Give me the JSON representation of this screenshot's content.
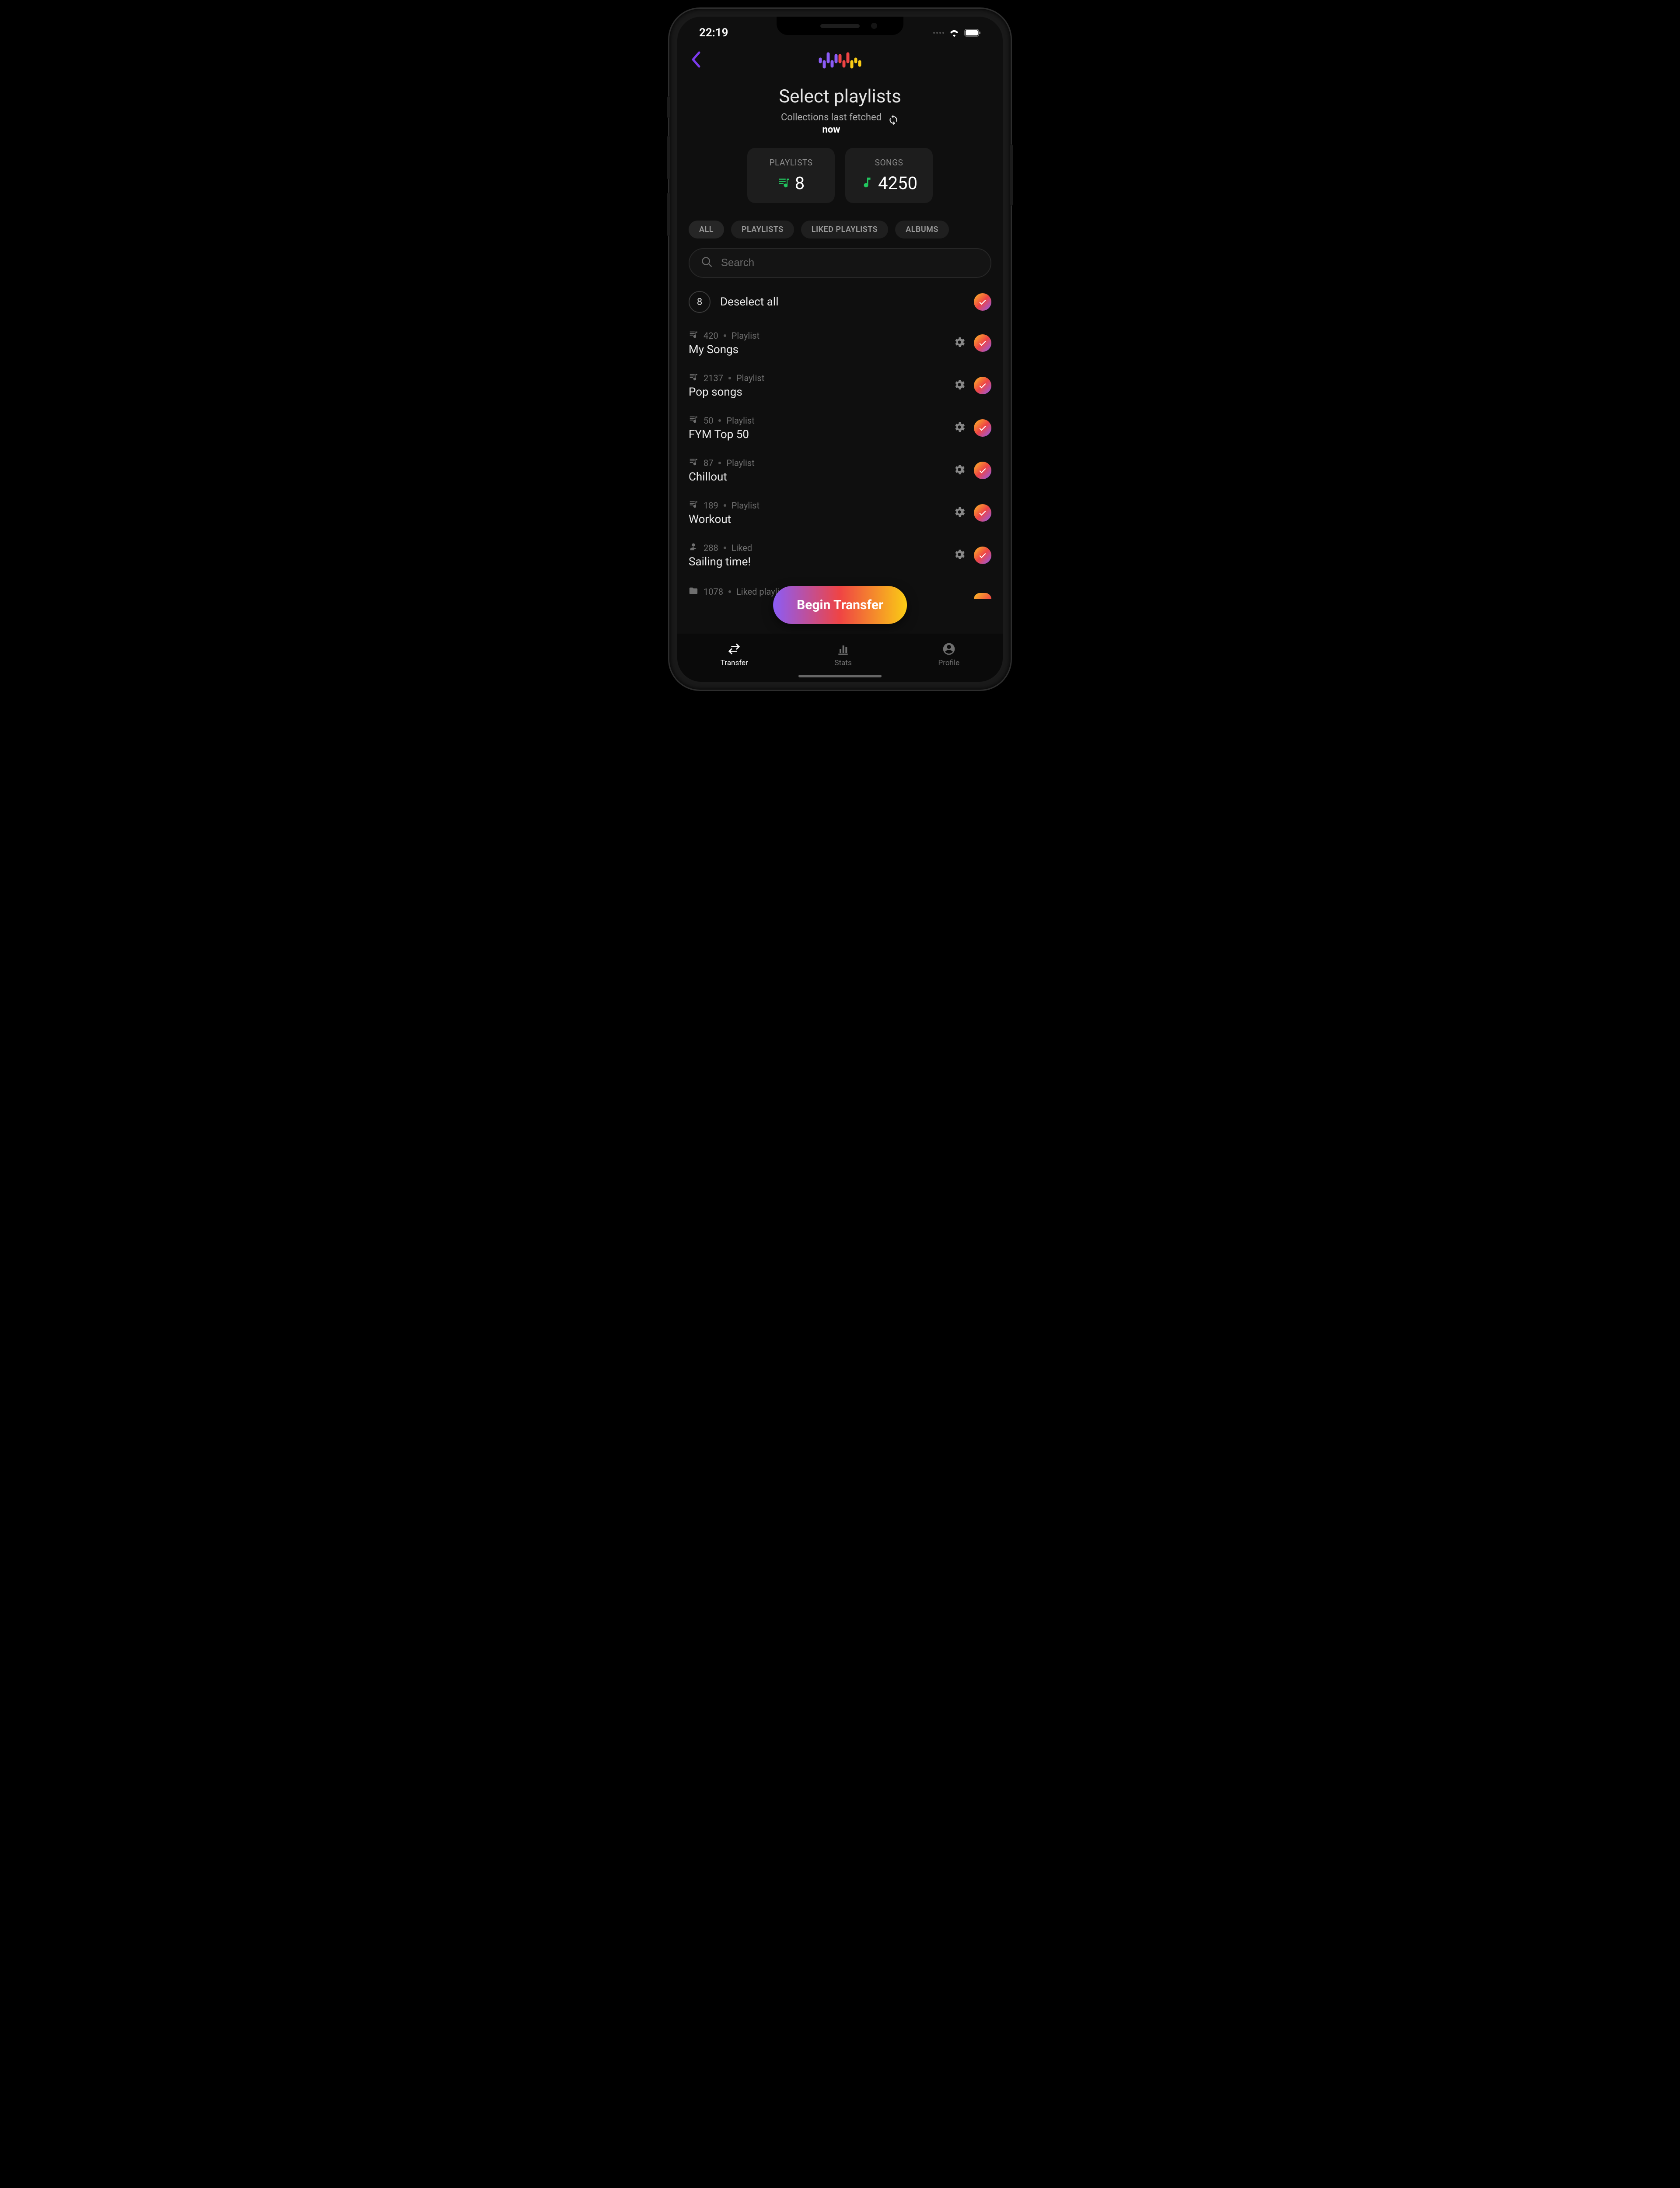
{
  "status": {
    "time": "22:19"
  },
  "header": {
    "title": "Select playlists",
    "subtitle_line": "Collections last fetched",
    "subtitle_time": "now"
  },
  "stats": {
    "playlists_label": "PLAYLISTS",
    "playlists_value": "8",
    "songs_label": "SONGS",
    "songs_value": "4250"
  },
  "filters": {
    "f0": "ALL",
    "f1": "PLAYLISTS",
    "f2": "LIKED PLAYLISTS",
    "f3": "ALBUMS"
  },
  "search": {
    "placeholder": "Search"
  },
  "deselect": {
    "count": "8",
    "label": "Deselect all"
  },
  "rows": {
    "r0": {
      "count": "420",
      "type": "Playlist",
      "title": "My Songs"
    },
    "r1": {
      "count": "2137",
      "type": "Playlist",
      "title": "Pop songs"
    },
    "r2": {
      "count": "50",
      "type": "Playlist",
      "title": "FYM Top 50"
    },
    "r3": {
      "count": "87",
      "type": "Playlist",
      "title": "Chillout"
    },
    "r4": {
      "count": "189",
      "type": "Playlist",
      "title": "Workout"
    },
    "r5": {
      "count": "288",
      "type": "Liked",
      "title": "Sailing time!"
    },
    "r6": {
      "count": "1078",
      "type": "Liked playlist",
      "title": ""
    }
  },
  "cta": {
    "label": "Begin Transfer"
  },
  "tabs": {
    "t0": "Transfer",
    "t1": "Stats",
    "t2": "Profile"
  }
}
